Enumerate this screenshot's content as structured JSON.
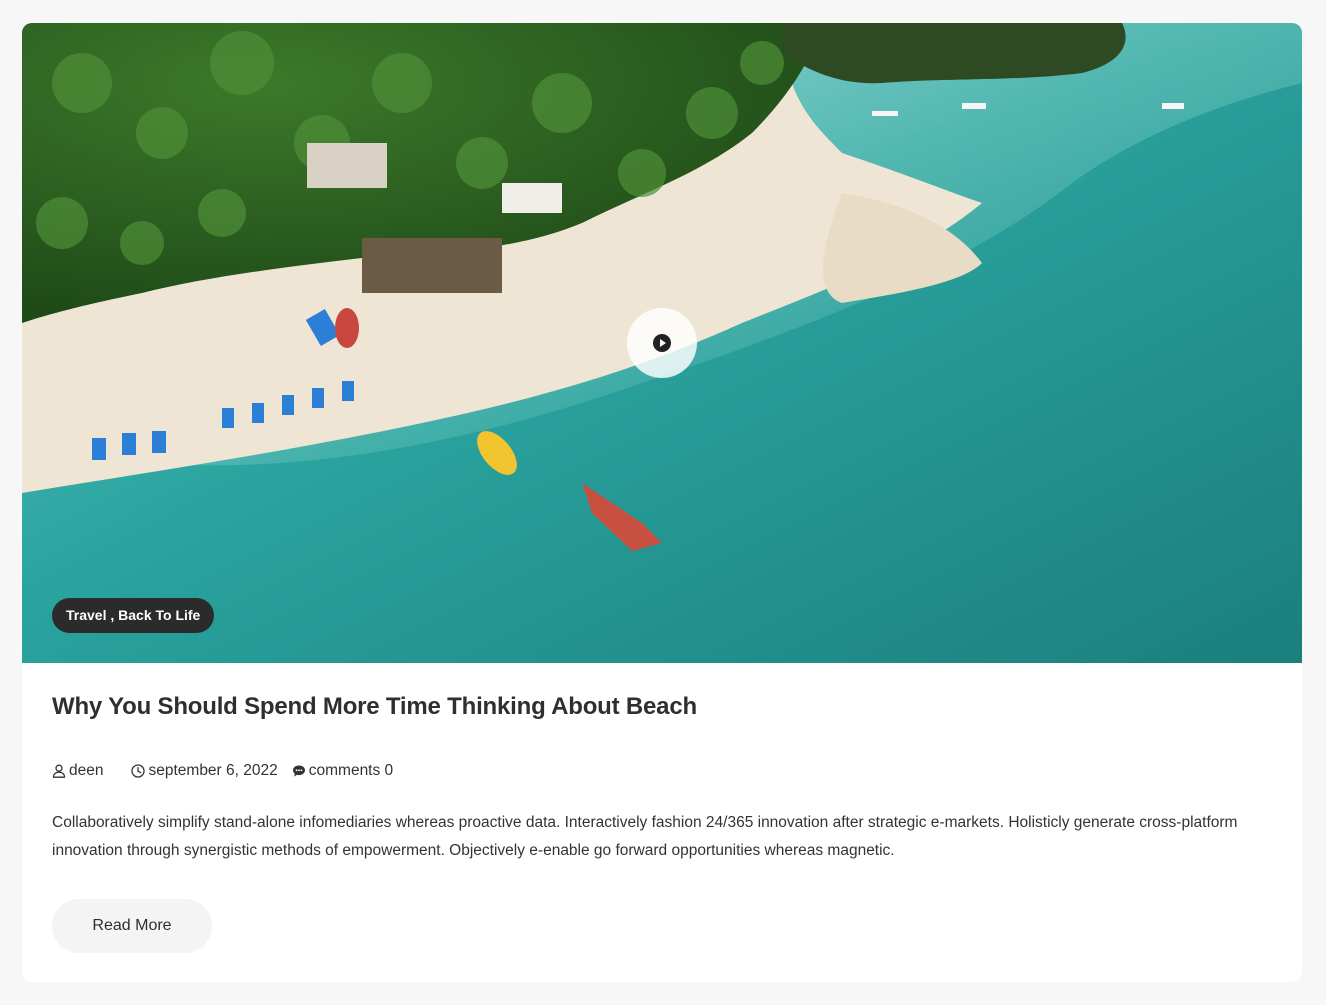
{
  "post": {
    "categories_label": "Travel , Back To Life",
    "title": "Why You Should Spend More Time Thinking About Beach",
    "author": "deen",
    "date": "september 6, 2022",
    "comments": "comments 0",
    "excerpt": "Collaboratively simplify stand-alone infomediaries whereas proactive data. Interactively fashion 24/365 innovation after strategic e-markets. Holisticly generate cross-platform innovation through synergistic methods of empowerment. Objectively e-enable go forward opportunities whereas magnetic.",
    "read_more_label": "Read More"
  },
  "media": {
    "type": "video",
    "subject": "aerial beach with palm trees and turquoise sea"
  },
  "icons": {
    "play": "play-icon",
    "author": "user-icon",
    "date": "clock-icon",
    "comments": "comment-icon"
  },
  "colors": {
    "page_background": "#f7f7f7",
    "card_background": "#ffffff",
    "badge_background": "#2b2b2b",
    "title_text": "#2f2f2f",
    "body_text": "#333333",
    "button_background": "#f4f4f4"
  }
}
